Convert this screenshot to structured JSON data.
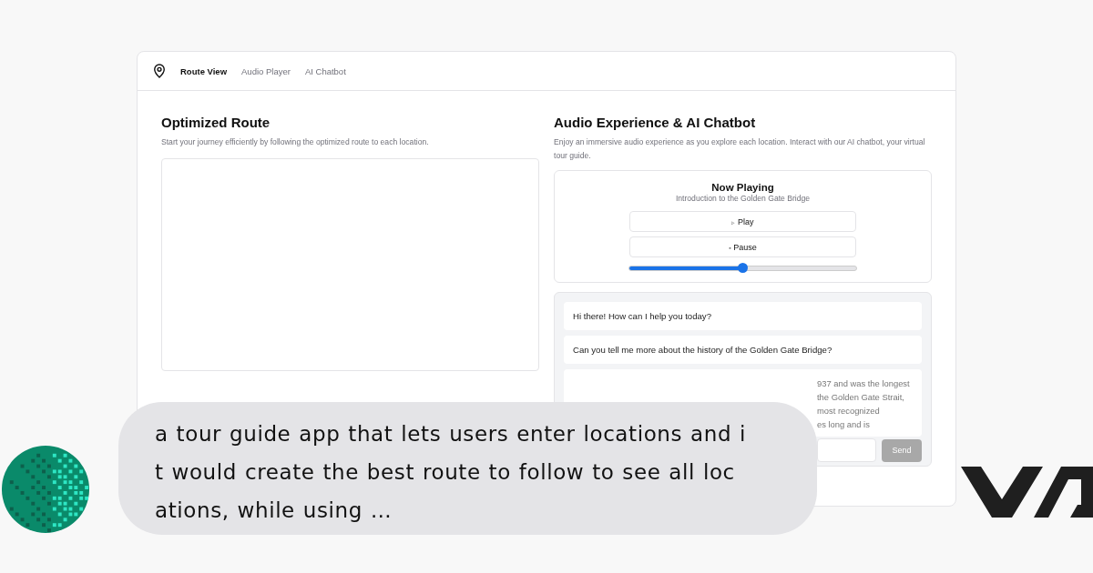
{
  "nav": {
    "tabs": [
      {
        "label": "Route View",
        "selected": true
      },
      {
        "label": "Audio Player",
        "selected": false
      },
      {
        "label": "AI Chatbot",
        "selected": false
      }
    ]
  },
  "route": {
    "title": "Optimized Route",
    "description": "Start your journey efficiently by following the optimized route to each location."
  },
  "audio": {
    "title": "Audio Experience & AI Chatbot",
    "description": "Enjoy an immersive audio experience as you explore each location. Interact with our AI chatbot, your virtual tour guide.",
    "player": {
      "heading": "Now Playing",
      "track": "Introduction to the Golden Gate Bridge",
      "buttons": [
        {
          "icon": "▹",
          "label": "Play"
        },
        {
          "icon": "▪",
          "label": "Pause"
        }
      ],
      "level": 0.5
    }
  },
  "chat": {
    "messages": [
      {
        "lines": [
          "Hi there! How can I help you today?"
        ]
      },
      {
        "lines": [
          "Can you tell me more about the history of the Golden Gate Bridge?"
        ]
      },
      {
        "lines": [
          "937 and was the longest",
          "the Golden Gate Strait,",
          "most recognized",
          "es long and is"
        ],
        "kind": "partial"
      }
    ],
    "send": {
      "label": "Send",
      "disabled": true
    }
  },
  "prompt": {
    "lines": [
      "a tour guide app that lets users enter locations and i",
      "t would create the best route to follow to see all loc",
      "ations, while using …"
    ]
  }
}
